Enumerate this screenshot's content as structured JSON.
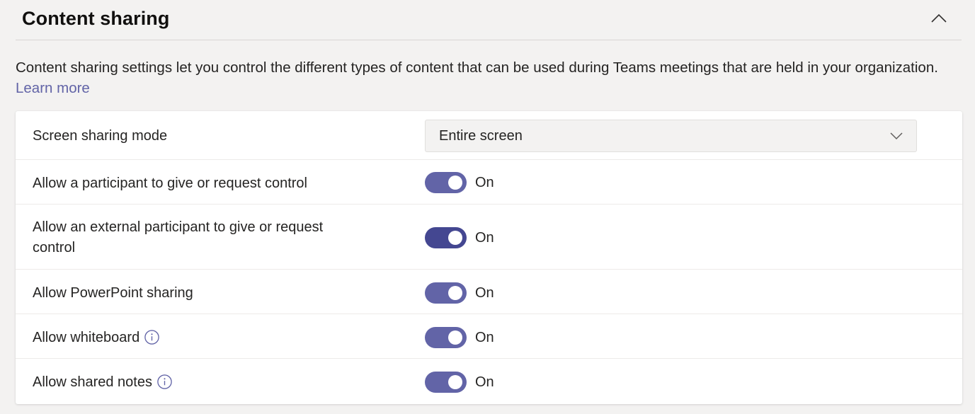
{
  "section": {
    "title": "Content sharing",
    "collapse_icon": "chevron-up-icon"
  },
  "description": {
    "text": "Content sharing settings let you control the different types of content that can be used during Teams meetings that are held in your organization.",
    "link_label": "Learn more"
  },
  "settings": {
    "screen_sharing": {
      "label": "Screen sharing mode",
      "value": "Entire screen",
      "chevron_icon": "chevron-down-icon"
    },
    "give_request_control": {
      "label": "Allow a participant to give or request control",
      "state": "On",
      "color": "#6264a7"
    },
    "external_control": {
      "label": "Allow an external participant to give or request control",
      "state": "On",
      "color": "#444791"
    },
    "powerpoint_sharing": {
      "label": "Allow PowerPoint sharing",
      "state": "On",
      "color": "#6264a7"
    },
    "whiteboard": {
      "label": "Allow whiteboard",
      "state": "On",
      "color": "#6264a7",
      "info_icon": "info-icon"
    },
    "shared_notes": {
      "label": "Allow shared notes",
      "state": "On",
      "color": "#6264a7",
      "info_icon": "info-icon"
    }
  },
  "colors": {
    "accent": "#6264a7",
    "accent_hover": "#444791",
    "background": "#f3f2f1",
    "card": "#ffffff"
  }
}
